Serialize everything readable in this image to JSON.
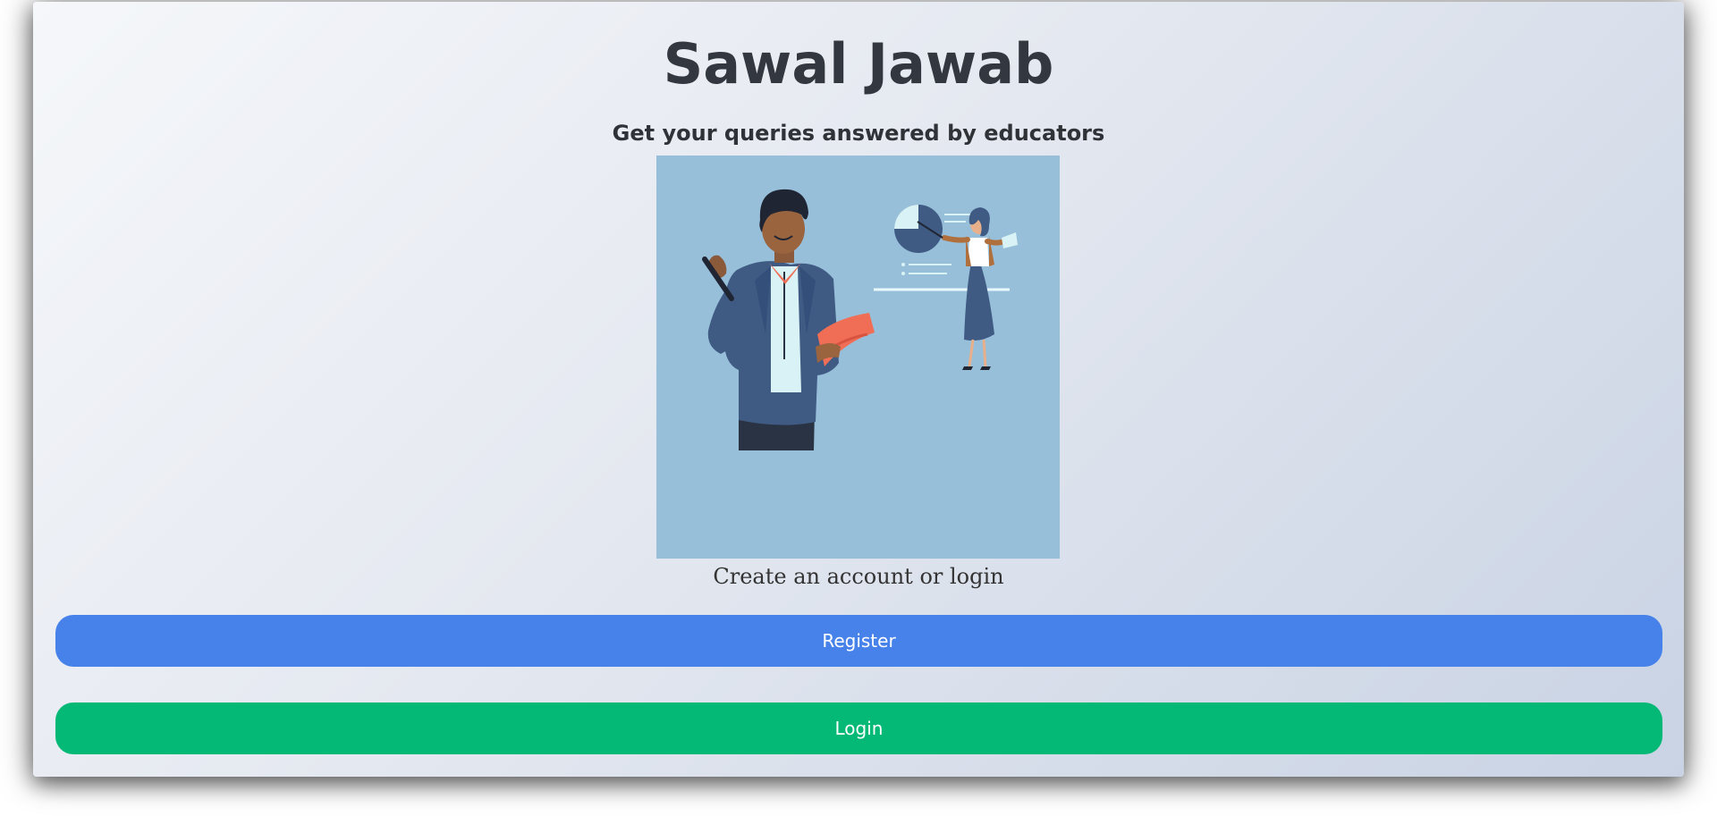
{
  "header": {
    "title": "Sawal Jawab",
    "subtitle": "Get your queries answered by educators"
  },
  "main": {
    "illustration": "teachers-presenting-illustration",
    "caption": "Create an account or login",
    "buttons": {
      "register_label": "Register",
      "login_label": "Login"
    }
  },
  "colors": {
    "register": "#4682ea",
    "login": "#03b975",
    "illustration_bg": "#98bfd9"
  }
}
